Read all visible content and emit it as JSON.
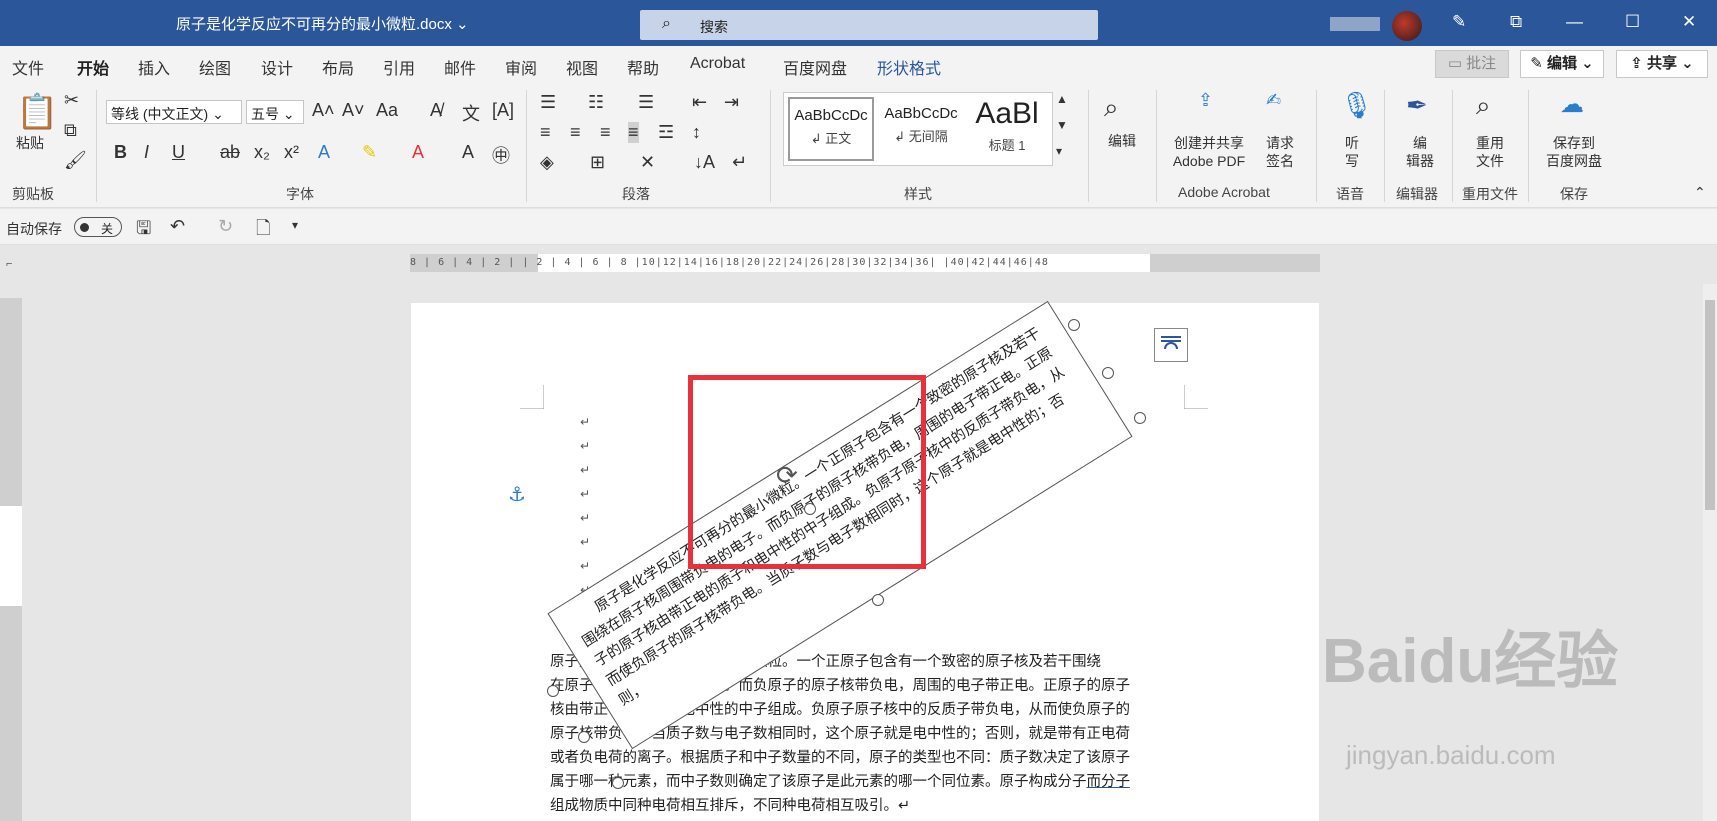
{
  "titlebar": {
    "doc_title": "原子是化学反应不可再分的最小微粒.docx",
    "search_placeholder": "搜索",
    "minimize": "—",
    "restore": "☐",
    "close": "✕"
  },
  "menubar": {
    "tabs": [
      "文件",
      "开始",
      "插入",
      "绘图",
      "设计",
      "布局",
      "引用",
      "邮件",
      "审阅",
      "视图",
      "帮助",
      "Acrobat",
      "百度网盘",
      "形状格式"
    ],
    "comments": "批注",
    "edit": "编辑",
    "share": "共享"
  },
  "ribbon": {
    "clipboard": {
      "paste": "粘贴",
      "label": "剪贴板"
    },
    "font": {
      "name": "等线 (中文正文)",
      "size": "五号",
      "label": "字体"
    },
    "paragraph": {
      "label": "段落"
    },
    "styles": {
      "label": "样式",
      "items": [
        {
          "preview": "AaBbCcDc",
          "name": "正文"
        },
        {
          "preview": "AaBbCcDc",
          "name": "无间隔"
        },
        {
          "preview": "AaBl",
          "name": "标题 1"
        }
      ]
    },
    "editing": {
      "btn": "编辑"
    },
    "acrobat": {
      "create": "创建并共享",
      "create2": "Adobe PDF",
      "sign": "请求",
      "sign2": "签名",
      "label": "Adobe Acrobat"
    },
    "voice": {
      "btn1": "听",
      "btn2": "写",
      "label": "语音"
    },
    "editor": {
      "btn1": "编",
      "btn2": "辑器",
      "label": "编辑器"
    },
    "reuse": {
      "btn1": "重用",
      "btn2": "文件",
      "label": "重用文件"
    },
    "save": {
      "btn1": "保存到",
      "btn2": "百度网盘",
      "label": "保存"
    }
  },
  "qat": {
    "autosave": "自动保存",
    "toggle": "关"
  },
  "ruler": {
    "marks": "8 | 6 | 4 | 2 |  | 2 | 4 | 6 | 8 |10|12|14|16|18|20|22|24|26|28|30|32|34|36|  |40|42|44|46|48"
  },
  "textbox": {
    "text": "原子是化学反应不可再分的最小微粒。一个正原子包含有一个致密的原子核及若干围绕在原子核周围带负电的电子。而负原子的原子核带负电，周围的电子带正电。正原子的原子核由带正电的质子和电中性的中子组成。负原子原子核中的反质子带负电，从而使负原子的原子核带负电。当质子数与电子数相同时，这个原子就是电中性的；否则，"
  },
  "body_lines": [
    "原子是化学反应不可再分的最小微粒。一个正原子包含有一个致密的原子核及若干围绕",
    "在原子核周围带负电的电子。而负原子的原子核带负电，周围的电子带正电。正原子的原子",
    "核由带正电的质子和电中性的中子组成。负原子原子核中的反质子带负电，从而使负原子的",
    "原子核带负电。当质子数与电子数相同时，这个原子就是电中性的；否则，就是带有正电荷",
    "或者负电荷的离子。根据质子和中子数量的不同，原子的类型也不同：质子数决定了该原子",
    "属于哪一种元素，而中子数则确定了该原子是此元素的哪一个同位素。原子构成分子",
    "组成物质中同种电荷相互排斥，不同种电荷相互吸引。↵"
  ],
  "body_link": "而分子",
  "watermark": {
    "main": "Baidu经验",
    "sub": "jingyan.baidu.com"
  }
}
